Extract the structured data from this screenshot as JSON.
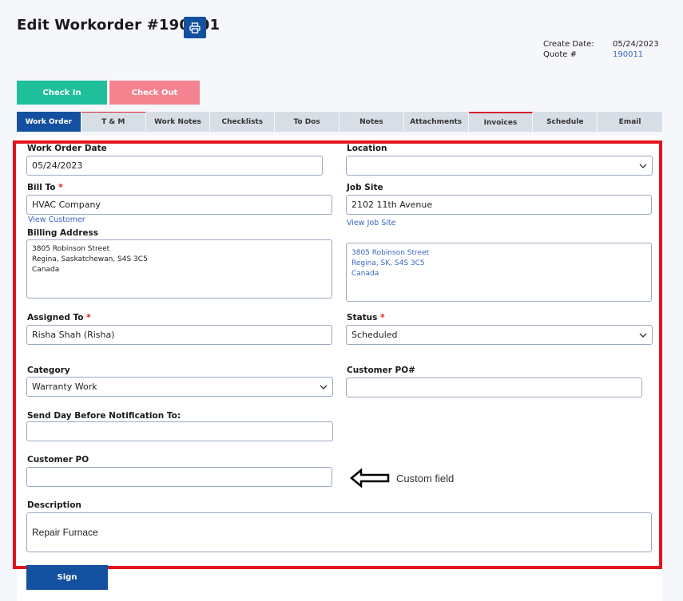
{
  "header": {
    "title": "Edit Workorder #190001",
    "create_date_label": "Create Date:",
    "create_date_value": "05/24/2023",
    "quote_label": "Quote #",
    "quote_value": "190011"
  },
  "actions": {
    "check_in": "Check In",
    "check_out": "Check Out"
  },
  "tabs": [
    {
      "label": "Work Order"
    },
    {
      "label": "T & M"
    },
    {
      "label": "Work Notes"
    },
    {
      "label": "Checklists"
    },
    {
      "label": "To Dos"
    },
    {
      "label": "Notes"
    },
    {
      "label": "Attachments"
    },
    {
      "label": "Invoices"
    },
    {
      "label": "Schedule"
    },
    {
      "label": "Email"
    }
  ],
  "form": {
    "work_order_date": {
      "label": "Work Order Date",
      "value": "05/24/2023"
    },
    "location": {
      "label": "Location",
      "value": ""
    },
    "bill_to": {
      "label": "Bill To",
      "required": "*",
      "value": "HVAC Company",
      "link": "View Customer"
    },
    "job_site": {
      "label": "Job Site",
      "value": "2102 11th Avenue",
      "link": "View Job Site"
    },
    "billing_address": {
      "label": "Billing Address",
      "value": "3805 Robinson Street\nRegina, Saskatchewan, S4S 3C5\nCanada"
    },
    "job_site_address": {
      "value": "3805 Robinson Street\nRegina, SK, S4S 3C5\nCanada"
    },
    "assigned_to": {
      "label": "Assigned To",
      "required": "*",
      "value": "Risha Shah (Risha)"
    },
    "status": {
      "label": "Status",
      "required": "*",
      "value": "Scheduled"
    },
    "category": {
      "label": "Category",
      "value": "Warranty Work"
    },
    "customer_po_num": {
      "label": "Customer PO#",
      "value": ""
    },
    "send_day_before": {
      "label": "Send Day Before Notification To:",
      "value": ""
    },
    "customer_po": {
      "label": "Customer PO",
      "value": ""
    },
    "description": {
      "label": "Description",
      "value": "Repair Furnace"
    }
  },
  "annotation": {
    "text": "Custom field"
  },
  "sign": {
    "label": "Sign"
  },
  "colors": {
    "primary": "#1450a0",
    "check_in": "#20bf9b",
    "check_out": "#f5838f",
    "highlight": "#e3121c",
    "link": "#3a66c4"
  }
}
